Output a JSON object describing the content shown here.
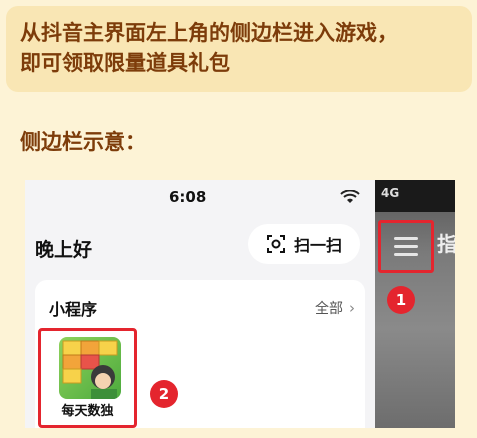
{
  "banner": {
    "line1": "从抖音主界面左上角的侧边栏进入游戏，",
    "line2": "即可领取限量道具礼包"
  },
  "section": {
    "title": "侧边栏示意："
  },
  "phone": {
    "status_time": "6:08",
    "greeting": "晚上好",
    "scan_label": "扫一扫",
    "card": {
      "title": "小程序",
      "all_label": "全部",
      "app_label": "每天数独"
    }
  },
  "side": {
    "status_text": "4G",
    "partial_text": "指"
  },
  "badges": {
    "first": "1",
    "second": "2"
  },
  "colors": {
    "page_bg": "#fdf3d6",
    "banner_bg": "#f9e6b4",
    "title_text": "#7d3c0a",
    "highlight_red": "#e4252e"
  },
  "icons": [
    "wifi-icon",
    "scan-icon",
    "chevron-right-icon",
    "menu-icon"
  ]
}
